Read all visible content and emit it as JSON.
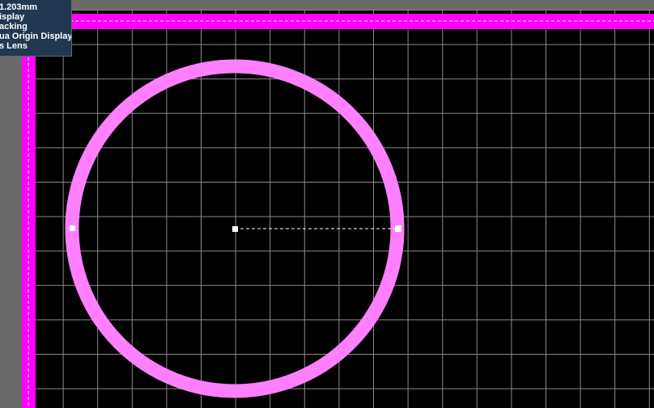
{
  "hud": {
    "lines": [
      "1.203mm",
      "isplay",
      "acking",
      "ua Origin Display",
      "s Lens"
    ]
  },
  "colors": {
    "board_edge": "#ff00ff",
    "arc": "#ff80ff",
    "grid": "#8a8a8a",
    "background": "#000000",
    "hud_background": "#223850",
    "margin": "#6b6868"
  },
  "icons": {
    "center_handle": "square-handle",
    "radius_handle": "square-handle",
    "left_handle": "square-handle"
  }
}
